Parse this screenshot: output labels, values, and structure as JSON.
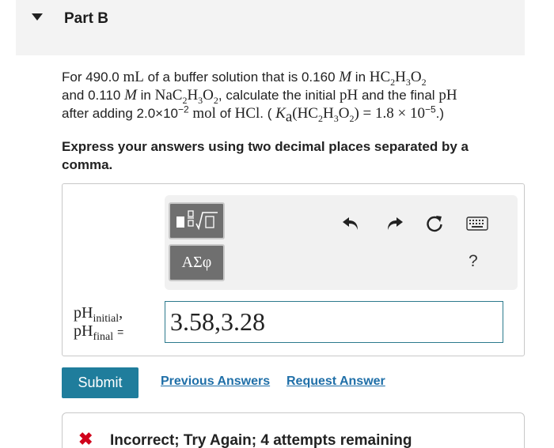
{
  "part": {
    "title": "Part B"
  },
  "question": {
    "t1": "For 490.0 ",
    "u1": "mL",
    "t2": " of a buffer solution that is 0.160 ",
    "M1": "M",
    "t3": " in ",
    "chem1": "HC2H3O2",
    "t4": "and 0.110 ",
    "M2": "M",
    "t5": " in ",
    "chem2": "NaC2H3O2",
    "t6": ", calculate the initial ",
    "pH1": "pH",
    "t7": " and the final ",
    "pH2": "pH",
    "t8": "after adding 2.0×10",
    "exp1": "−2",
    "t9": " ",
    "u2": "mol",
    "t10": " of ",
    "chem3": "HCl",
    "t11": ". ( ",
    "ka": "K",
    "ka_sub": "a",
    "ka_expr": "(HC2H3O2) = 1.8 × 10",
    "ka_exp": "−5",
    "t12": ".)"
  },
  "instruction": "Express your answers using two decimal places separated by a comma.",
  "toolbar": {
    "templates_label": "templates",
    "symbols_label": "ΑΣφ",
    "help_label": "?"
  },
  "answer": {
    "label_ph": "pH",
    "label_initial": "initial",
    "label_comma": ",",
    "label_final": "final",
    "label_eq": "=",
    "value": "3.58,3.28"
  },
  "actions": {
    "submit": "Submit",
    "previous_answers": "Previous Answers",
    "request_answer": "Request Answer"
  },
  "feedback": {
    "text": "Incorrect; Try Again; 4 attempts remaining"
  },
  "colors": {
    "accent": "#1f7d9c",
    "link": "#1f6fa8",
    "error": "#d0021b"
  }
}
